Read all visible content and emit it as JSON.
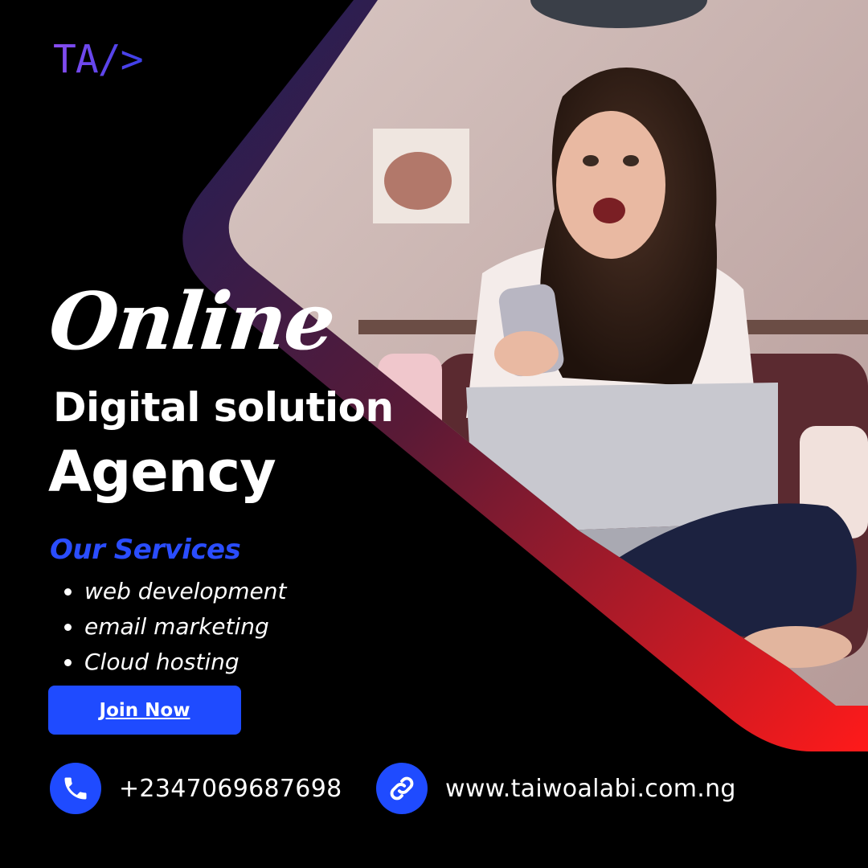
{
  "logo": {
    "text": "TA/>"
  },
  "headline": {
    "line1": "Online",
    "line2": "Digital solution",
    "line3": "Agency"
  },
  "services": {
    "title": "Our Services",
    "items": [
      "web development",
      "email marketing",
      "Cloud hosting"
    ]
  },
  "cta": {
    "label": "Join Now"
  },
  "contact": {
    "phone": "+2347069687698",
    "website": "www.taiwoalabi.com.ng"
  },
  "colors": {
    "background": "#000000",
    "accent_blue": "#1f4bff",
    "gradient_start": "#1b1f5a",
    "gradient_mid": "#6b1a2e",
    "gradient_end": "#ff1a1a"
  },
  "icons": {
    "phone": "phone-icon",
    "link": "link-icon"
  }
}
